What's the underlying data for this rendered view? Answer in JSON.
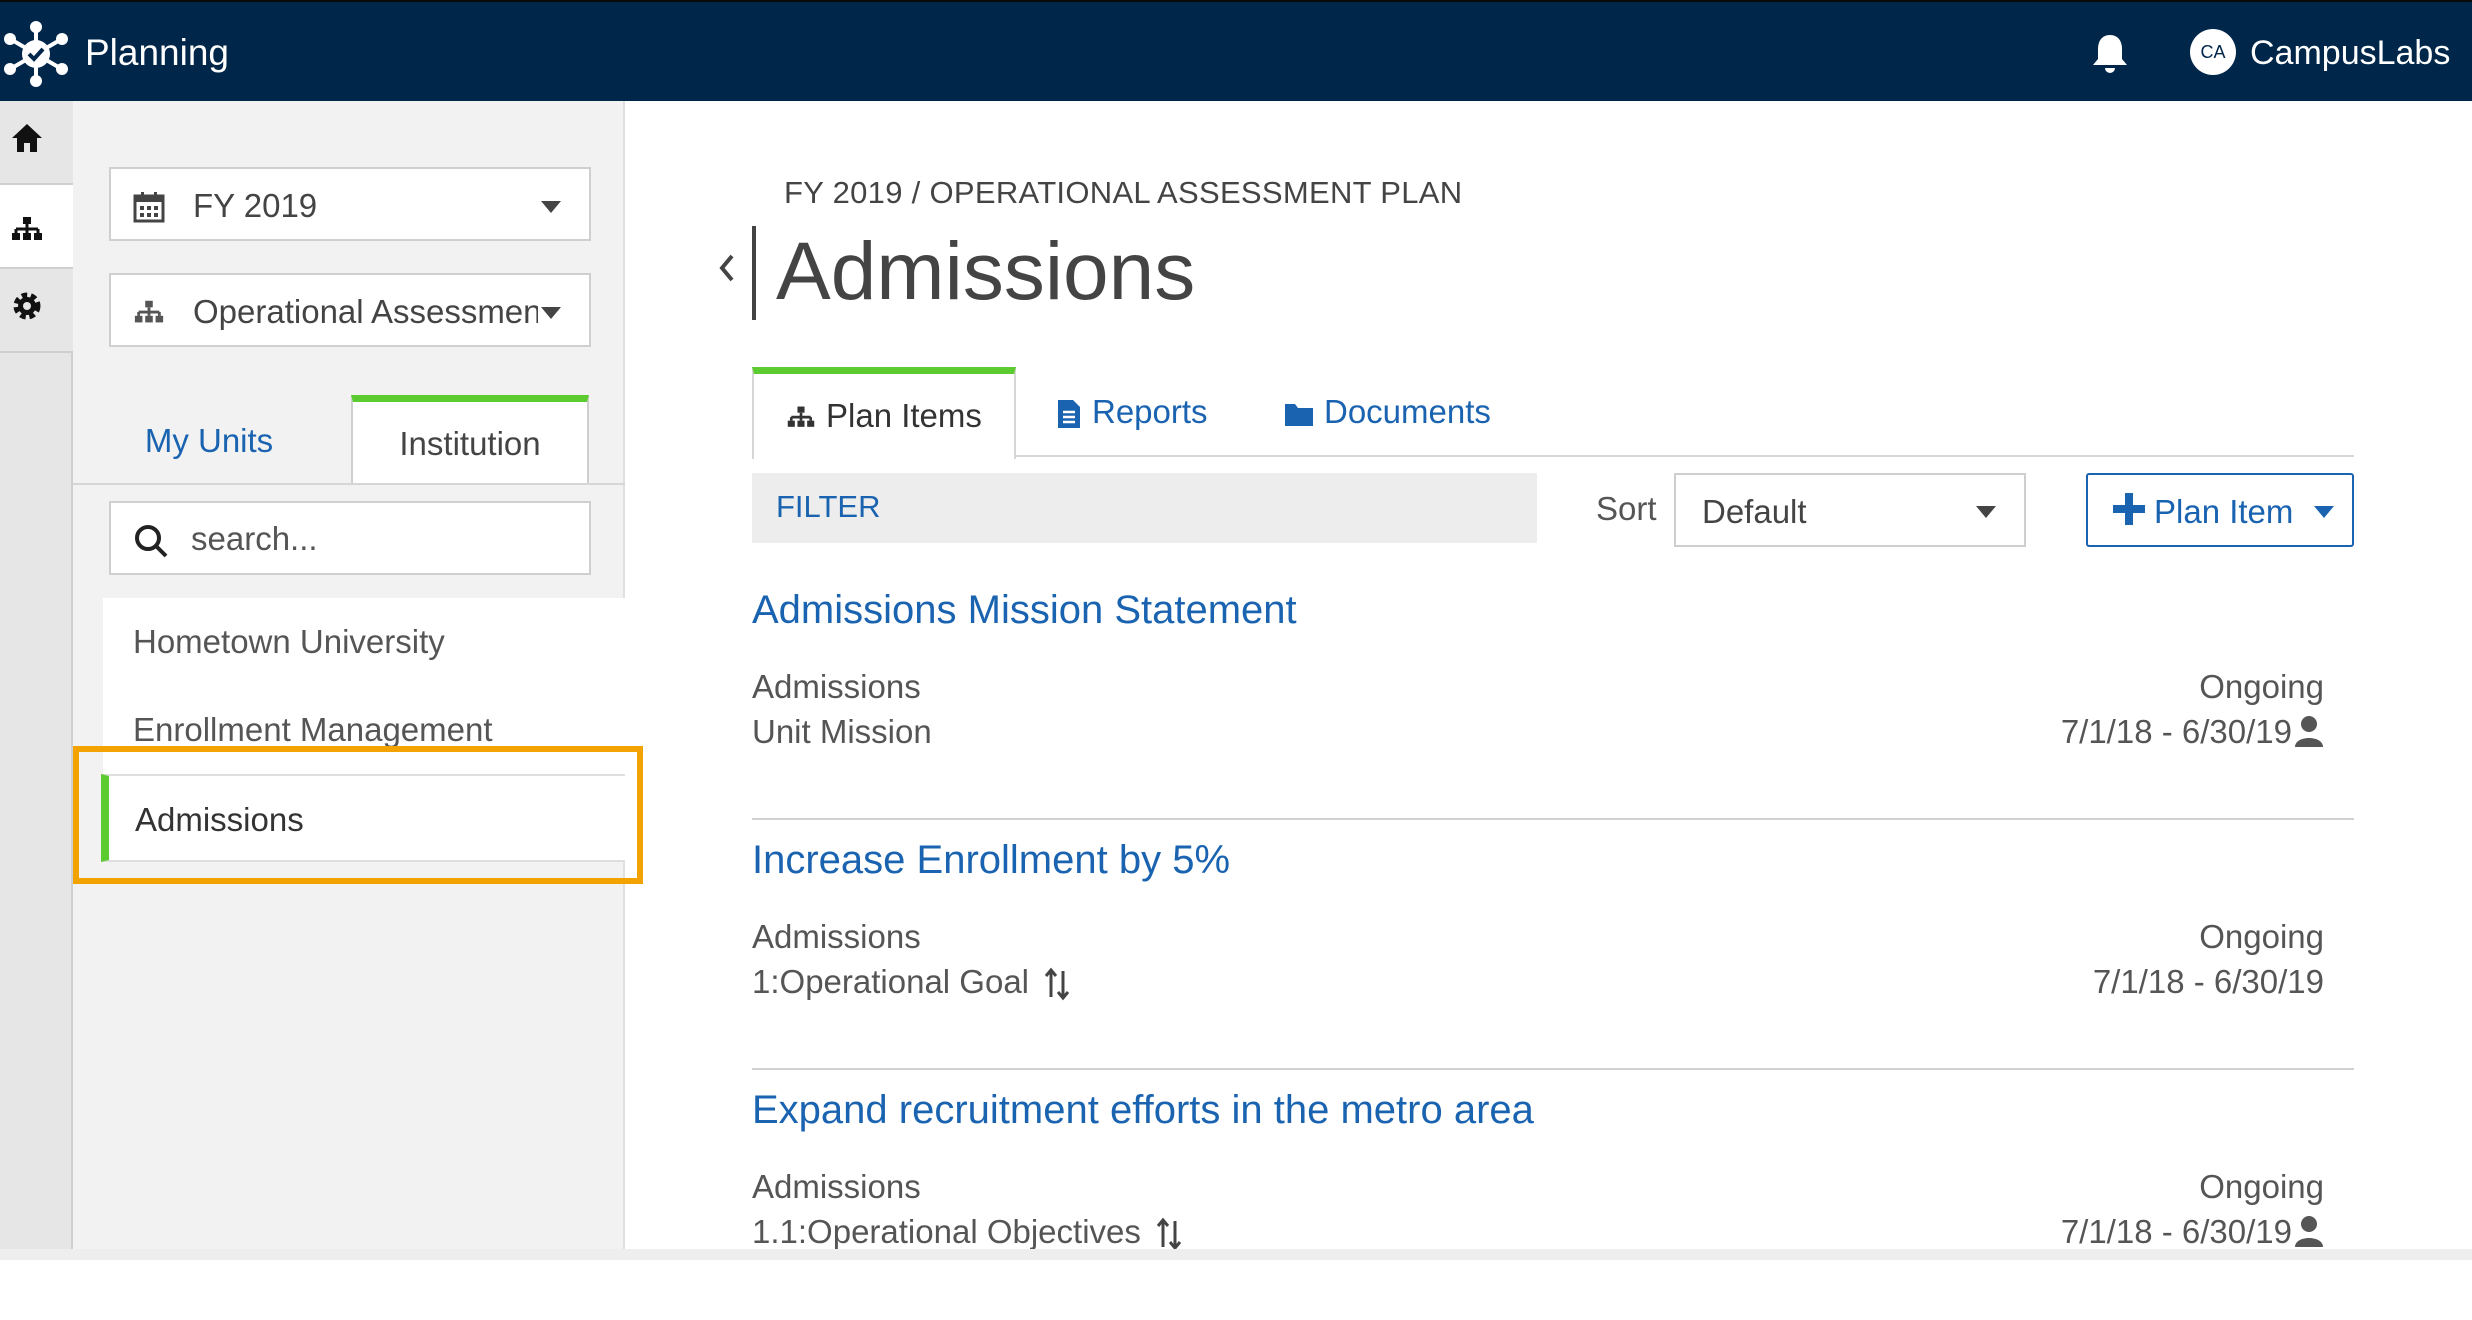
{
  "topbar": {
    "app_title": "Planning",
    "avatar_initials": "CA",
    "user_name": "CampusLabs",
    "bar_color": "#00264a"
  },
  "sidebar": {
    "year_select": "FY 2019",
    "plan_select": "Operational Assessment",
    "tabs": {
      "my_units": "My Units",
      "institution": "Institution"
    },
    "search_placeholder": "search...",
    "tree": [
      {
        "label": "Hometown University"
      },
      {
        "label": "Enrollment Management"
      },
      {
        "label": "Admissions"
      }
    ]
  },
  "main": {
    "breadcrumb": "FY 2019 / OPERATIONAL ASSESSMENT PLAN",
    "title": "Admissions",
    "tabs": {
      "plan_items": "Plan Items",
      "reports": "Reports",
      "documents": "Documents"
    },
    "filter_label": "FILTER",
    "sort_label": "Sort",
    "sort_value": "Default",
    "add_button": "Plan Item",
    "items": [
      {
        "title": "Admissions Mission Statement",
        "unit": "Admissions",
        "type": "Unit Mission",
        "status": "Ongoing",
        "dates": "7/1/18 - 6/30/19"
      },
      {
        "title": "Increase Enrollment by 5%",
        "unit": "Admissions",
        "type": "1:Operational Goal",
        "status": "Ongoing",
        "dates": "7/1/18 - 6/30/19"
      },
      {
        "title": "Expand recruitment efforts in the metro area",
        "unit": "Admissions",
        "type": "1.1:Operational Objectives",
        "status": "Ongoing",
        "dates": "7/1/18 - 6/30/19"
      }
    ]
  },
  "colors": {
    "accent_green": "#5ccb2f",
    "link_blue": "#1a63b0",
    "highlight_orange": "#f2a300"
  }
}
